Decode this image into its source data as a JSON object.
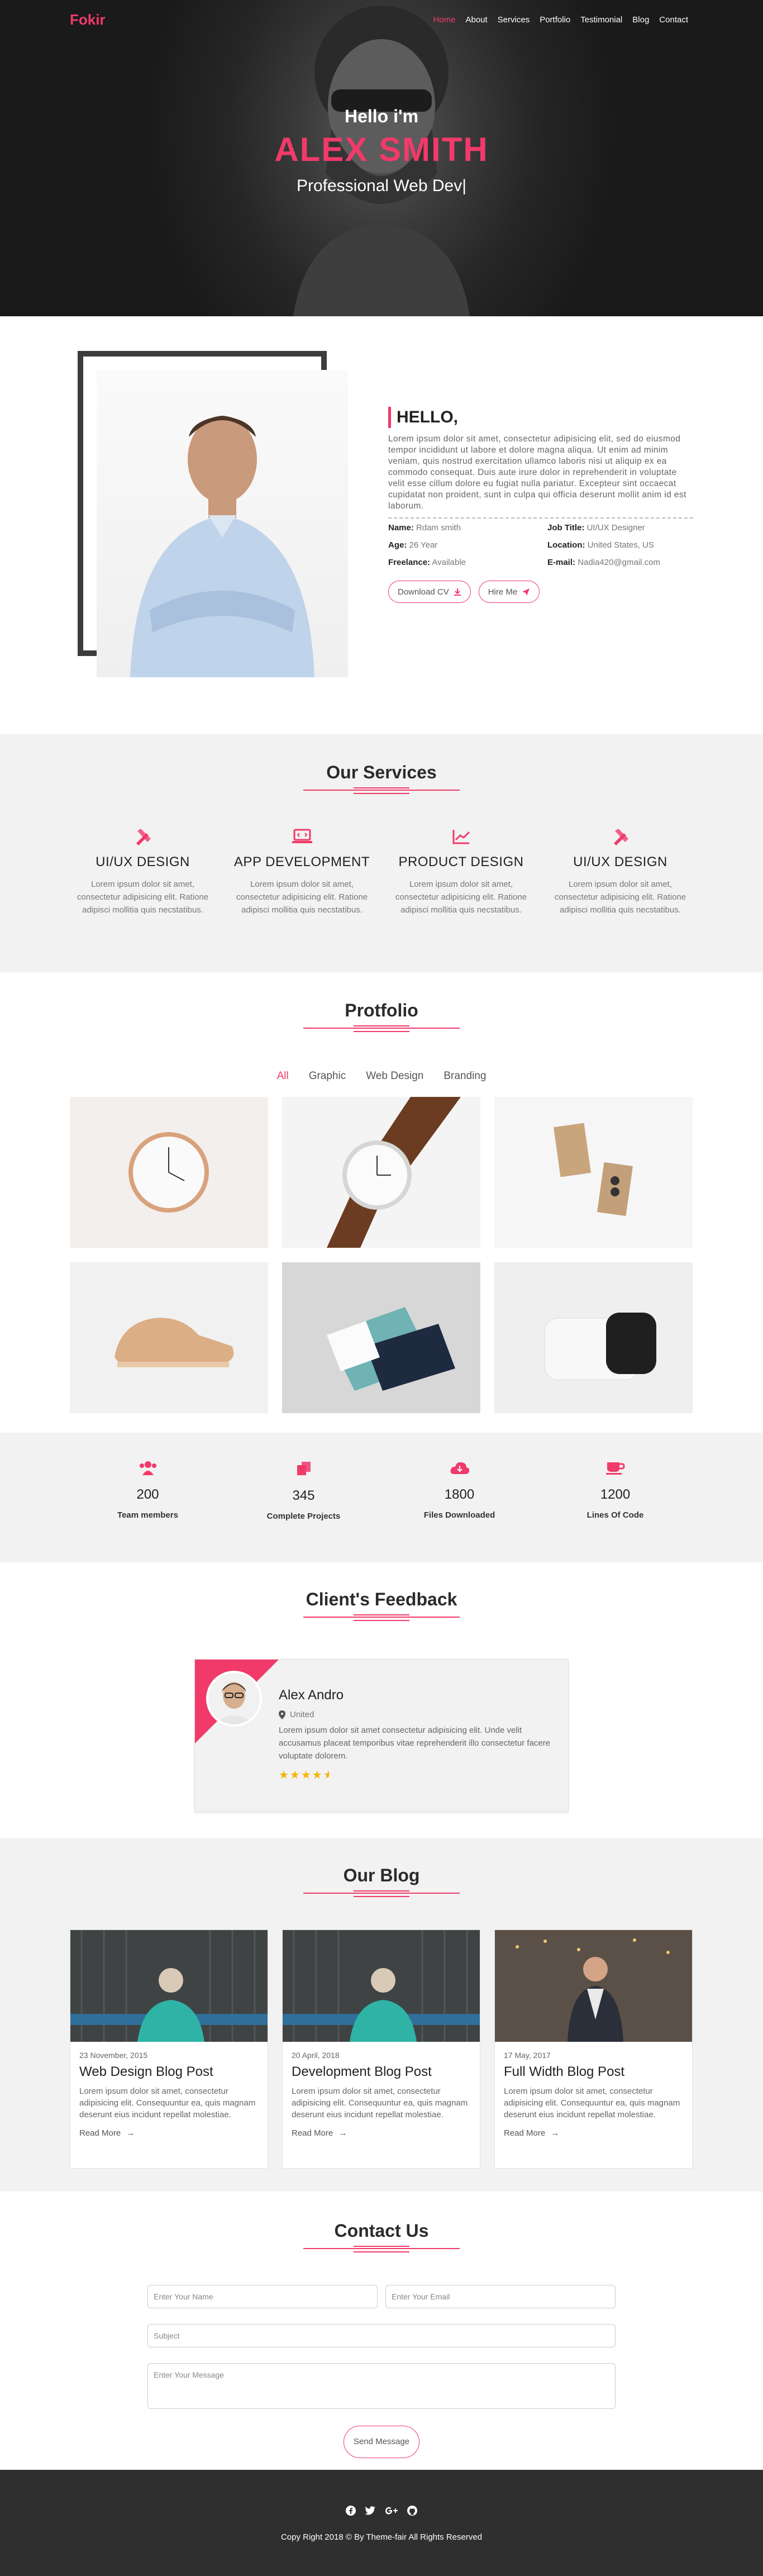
{
  "nav": {
    "logo": "Fokir",
    "items": [
      "Home",
      "About",
      "Services",
      "Portfolio",
      "Testimonial",
      "Blog",
      "Contact"
    ],
    "active_index": 0
  },
  "hero": {
    "greeting": "Hello i'm",
    "name": "ALEX SMITH",
    "role": "Professional Web Dev|"
  },
  "about": {
    "heading": "HELLO,",
    "paragraph": "Lorem ipsum dolor sit amet, consectetur adipisicing elit, sed do eiusmod tempor incididunt ut labore et dolore magna aliqua. Ut enim ad minim veniam, quis nostrud exercitation ullamco laboris nisi ut aliquip ex ea commodo consequat. Duis aute irure dolor in reprehenderit in voluptate velit esse cillum dolore eu fugiat nulla pariatur. Excepteur sint occaecat cupidatat non proident, sunt in culpa qui officia deserunt mollit anim id est laborum.",
    "details": [
      {
        "label": "Name:",
        "value": "Rdam smith"
      },
      {
        "label": "Job Title:",
        "value": "UI/UX Designer"
      },
      {
        "label": "Age:",
        "value": "26 Year"
      },
      {
        "label": "Location:",
        "value": "United States, US"
      },
      {
        "label": "Freelance:",
        "value": "Available"
      },
      {
        "label": "E-mail:",
        "value": "Nadia420@gmail.com"
      }
    ],
    "download_cv": "Download CV",
    "hire_me": "Hire Me"
  },
  "services": {
    "title": "Our Services",
    "items": [
      {
        "icon": "pencil-ruler-icon",
        "title": "UI/UX DESIGN",
        "text": "Lorem ipsum dolor sit amet, consectetur adipisicing elit. Ratione adipisci mollitia quis necstatibus."
      },
      {
        "icon": "laptop-code-icon",
        "title": "APP DEVELOPMENT",
        "text": "Lorem ipsum dolor sit amet, consectetur adipisicing elit. Ratione adipisci mollitia quis necstatibus."
      },
      {
        "icon": "chart-line-icon",
        "title": "PRODUCT DESIGN",
        "text": "Lorem ipsum dolor sit amet, consectetur adipisicing elit. Ratione adipisci mollitia quis necstatibus."
      },
      {
        "icon": "pencil-ruler-icon",
        "title": "UI/UX DESIGN",
        "text": "Lorem ipsum dolor sit amet, consectetur adipisicing elit. Ratione adipisci mollitia quis necstatibus."
      }
    ]
  },
  "portfolio": {
    "title": "Protfolio",
    "filters": [
      "All",
      "Graphic",
      "Web Design",
      "Branding"
    ],
    "active_filter": 0,
    "tiles": [
      "wall-clock",
      "wrist-watch",
      "business-cards",
      "sneaker",
      "brand-cards",
      "portable-speaker"
    ]
  },
  "stats": [
    {
      "icon": "users-icon",
      "value": "200",
      "label": "Team members"
    },
    {
      "icon": "copy-icon",
      "value": "345",
      "label": "Complete Projects"
    },
    {
      "icon": "cloud-download-icon",
      "value": "1800",
      "label": "Files Downloaded"
    },
    {
      "icon": "coffee-icon",
      "value": "1200",
      "label": "Lines Of Code"
    }
  ],
  "feedback": {
    "title": "Client's Feedback",
    "name": "Alex Andro",
    "location": "United",
    "text": "Lorem ipsum dolor sit amet consectetur adipisicing elit. Unde velit accusamus placeat temporibus vitae reprehenderit illo consectetur facere voluptate dolorem.",
    "rating": 4.5
  },
  "blog": {
    "title": "Our Blog",
    "posts": [
      {
        "date": "23 November, 2015",
        "title": "Web Design Blog Post",
        "text": "Lorem ipsum dolor sit amet, consectetur adipisicing elit. Consequuntur ea, quis magnam deserunt eius incidunt repellat molestiae.",
        "more": "Read More"
      },
      {
        "date": "20 April, 2018",
        "title": "Development Blog Post",
        "text": "Lorem ipsum dolor sit amet, consectetur adipisicing elit. Consequuntur ea, quis magnam deserunt eius incidunt repellat molestiae.",
        "more": "Read More"
      },
      {
        "date": "17 May, 2017",
        "title": "Full Width Blog Post",
        "text": "Lorem ipsum dolor sit amet, consectetur adipisicing elit. Consequuntur ea, quis magnam deserunt eius incidunt repellat molestiae.",
        "more": "Read More"
      }
    ]
  },
  "contact": {
    "title": "Contact Us",
    "name_placeholder": "Enter Your Name",
    "email_placeholder": "Enter Your Email",
    "subject_placeholder": "Subject",
    "message_placeholder": "Enter Your Message",
    "send": "Send Message"
  },
  "footer": {
    "social": [
      "facebook-icon",
      "twitter-icon",
      "google-plus-icon",
      "github-icon"
    ],
    "copyright": "Copy Right 2018 © By Theme-fair All Rights Reserved"
  },
  "colors": {
    "accent": "#f13a6a",
    "dark": "#2f2f2f",
    "light": "#f2f2f2"
  }
}
